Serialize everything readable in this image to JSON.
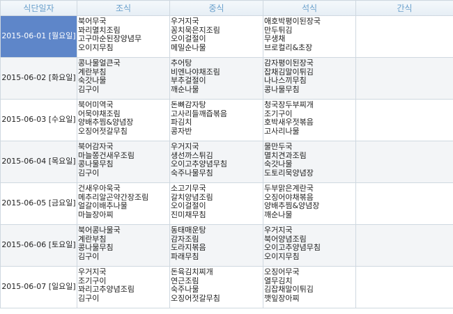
{
  "headers": {
    "date": "식단일자",
    "breakfast": "조식",
    "lunch": "중식",
    "dinner": "석식",
    "snack": "간식"
  },
  "rows": [
    {
      "date": "2015-06-01 [월요일]",
      "breakfast": [
        "북어무국",
        "꽈리멸치조림",
        "고구마순된장양념무",
        "오이지무침"
      ],
      "lunch": [
        "우거지국",
        "꽁치묵은지조림",
        "오이걸절이",
        "메밀순나물"
      ],
      "dinner": [
        "애호박평이된장국",
        "만두튀김",
        "무생채",
        "브로컬리&초장"
      ],
      "snack": []
    },
    {
      "date": "2015-06-02 [화요일]",
      "breakfast": [
        "콩나물얼큰국",
        "계란부침",
        "숙갓나물",
        "김구이"
      ],
      "lunch": [
        "추어탕",
        "비엔나야채조림",
        "부추걸절이",
        "깨순나물"
      ],
      "dinner": [
        "감자평이된장국",
        "잡채김말이튀김",
        "나나스끼무침",
        "콩나물무침"
      ],
      "snack": []
    },
    {
      "date": "2015-06-03 [수요일]",
      "breakfast": [
        "북어미역국",
        "어묵야채조림",
        "양배추찜&양념장",
        "오징어젓갈무침"
      ],
      "lunch": [
        "돈뼈감자탕",
        "고사리들깨즙볶음",
        "파김치",
        "콩자반"
      ],
      "dinner": [
        "청국장두부찌개",
        "조기구이",
        "호박새우젓볶음",
        "고사리나물"
      ],
      "snack": []
    },
    {
      "date": "2015-06-04 [목요일]",
      "breakfast": [
        "북어감자국",
        "마늘쫑건새우조림",
        "콩나물무침",
        "김구이"
      ],
      "lunch": [
        "우거지국",
        "생선까스튀김",
        "오이고추양념무침",
        "숙주나물무침"
      ],
      "dinner": [
        "물만두국",
        "멸치견과조림",
        "숙갓나물",
        "도토리묵양념장"
      ],
      "snack": []
    },
    {
      "date": "2015-06-05 [금요일]",
      "breakfast": [
        "건새우아욱국",
        "메추리알곤약간장조림",
        "얼갈이배추나물",
        "마늘장아찌"
      ],
      "lunch": [
        "소고기무국",
        "갈치양념조림",
        "오이걸절이",
        "진미채무침"
      ],
      "dinner": [
        "두부맑은계란국",
        "오징어야채볶음",
        "양배추찜&양념장",
        "깨순나물"
      ],
      "snack": []
    },
    {
      "date": "2015-06-06 [토요일]",
      "breakfast": [
        "북어콩나물국",
        "계란부침",
        "콩나물무침",
        "김구이"
      ],
      "lunch": [
        "동태매운탕",
        "감자조림",
        "도라지볶음",
        "파래무침"
      ],
      "dinner": [
        "우거지국",
        "북어양념조림",
        "오이고추양념무침",
        "오이지무침"
      ],
      "snack": []
    },
    {
      "date": "2015-06-07 [일요일]",
      "breakfast": [
        "우거지국",
        "조기구이",
        "꽈리고추양념조림",
        "김구이"
      ],
      "lunch": [
        "돈육김치찌개",
        "연근조림",
        "숙주나물",
        "오징어젓갈무침"
      ],
      "dinner": [
        "오징어무국",
        "열무김치",
        "김잡채말이튀김",
        "깻잎장아찌"
      ],
      "snack": []
    }
  ],
  "active_row": 0,
  "colors": {
    "active_bg": "#5e86c9",
    "header_text": "#6aa0cc",
    "border": "#cfd8e0"
  }
}
